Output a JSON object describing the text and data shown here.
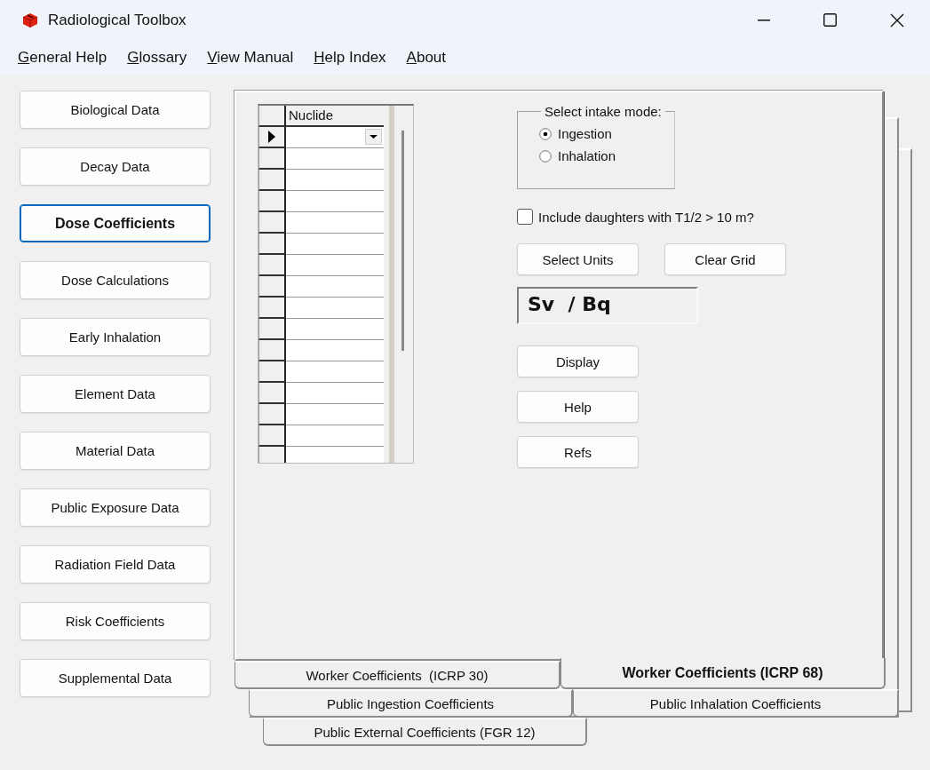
{
  "window": {
    "title": "Radiological Toolbox"
  },
  "menu": [
    "General Help",
    "Glossary",
    "View Manual",
    "Help Index",
    "About"
  ],
  "sidebar": {
    "items": [
      {
        "label": "Biological Data",
        "selected": false
      },
      {
        "label": "Decay Data",
        "selected": false
      },
      {
        "label": "Dose Coefficients",
        "selected": true
      },
      {
        "label": "Dose Calculations",
        "selected": false
      },
      {
        "label": "Early Inhalation",
        "selected": false
      },
      {
        "label": "Element Data",
        "selected": false
      },
      {
        "label": "Material Data",
        "selected": false
      },
      {
        "label": "Public Exposure Data",
        "selected": false
      },
      {
        "label": "Radiation Field Data",
        "selected": false
      },
      {
        "label": "Risk Coefficients",
        "selected": false
      },
      {
        "label": "Supplemental Data",
        "selected": false
      }
    ]
  },
  "grid": {
    "columns": [
      "Nuclide"
    ],
    "rows": [
      {
        "current": true
      },
      {
        "current": false
      },
      {
        "current": false
      },
      {
        "current": false
      },
      {
        "current": false
      },
      {
        "current": false
      },
      {
        "current": false
      },
      {
        "current": false
      },
      {
        "current": false
      },
      {
        "current": false
      },
      {
        "current": false
      },
      {
        "current": false
      },
      {
        "current": false
      },
      {
        "current": false
      },
      {
        "current": false
      },
      {
        "current": false
      }
    ]
  },
  "intake_mode": {
    "label": "Select intake mode:",
    "options": [
      {
        "label": "Ingestion",
        "selected": true
      },
      {
        "label": "Inhalation",
        "selected": false
      }
    ]
  },
  "include_daughters": {
    "label": "Include daughters with T1/2 > 10 m?",
    "checked": false
  },
  "unit_buttons": [
    "Select Units",
    "Clear Grid"
  ],
  "units_display": "Sv  / Bq",
  "action_buttons": [
    "Display",
    "Help",
    "Refs"
  ],
  "tab_rows": [
    [
      {
        "label": "Worker Coefficients  (ICRP 30)",
        "selected": false
      },
      {
        "label": "Worker Coefficients (ICRP 68)",
        "selected": true
      }
    ],
    [
      {
        "label": "Public Ingestion Coefficients",
        "selected": false
      },
      {
        "label": "Public Inhalation Coefficients",
        "selected": false
      }
    ],
    [
      {
        "label": "Public External Coefficients (FGR 12)",
        "selected": false
      }
    ]
  ]
}
